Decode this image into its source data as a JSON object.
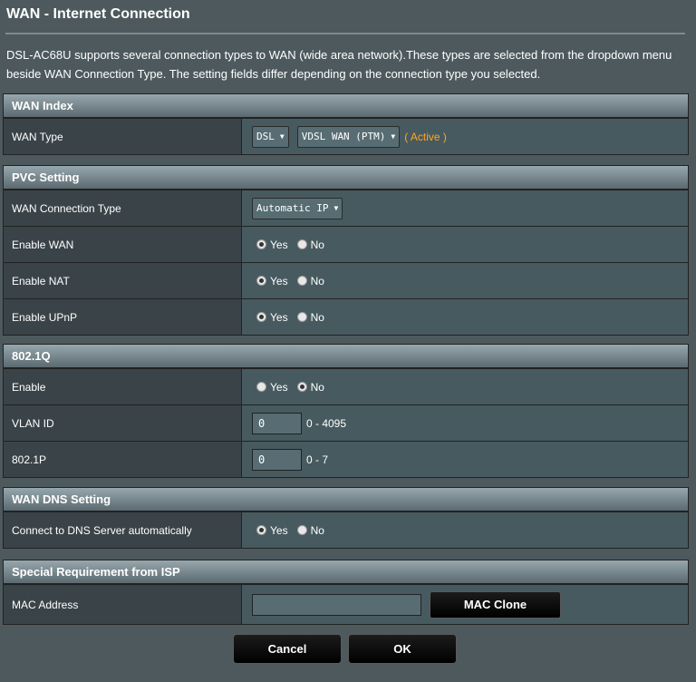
{
  "page": {
    "title": "WAN - Internet Connection",
    "description": "DSL-AC68U supports several connection types to WAN (wide area network).These types are selected from the dropdown menu beside WAN Connection Type. The setting fields differ depending on the connection type you selected."
  },
  "wan_index": {
    "header": "WAN Index",
    "wan_type_label": "WAN Type",
    "wan_type_select": "DSL",
    "wan_mode_select": "VDSL WAN (PTM)",
    "active_text": "( Active )"
  },
  "pvc": {
    "header": "PVC Setting",
    "conn_type_label": "WAN Connection Type",
    "conn_type_select": "Automatic IP",
    "enable_wan_label": "Enable WAN",
    "enable_nat_label": "Enable NAT",
    "enable_upnp_label": "Enable UPnP"
  },
  "dot1q": {
    "header": "802.1Q",
    "enable_label": "Enable",
    "vlan_label": "VLAN ID",
    "vlan_value": "0",
    "vlan_range": "0 - 4095",
    "p_label": "802.1P",
    "p_value": "0",
    "p_range": "0 - 7"
  },
  "dns": {
    "header": "WAN DNS Setting",
    "auto_label": "Connect to DNS Server automatically"
  },
  "isp": {
    "header": "Special Requirement from ISP",
    "mac_label": "MAC Address",
    "mac_value": "",
    "mac_clone_button": "MAC Clone"
  },
  "radio": {
    "yes": "Yes",
    "no": "No"
  },
  "footer": {
    "cancel": "Cancel",
    "ok": "OK"
  },
  "icons": {
    "dropdown": "chevron-down-icon"
  },
  "colors": {
    "background": "#4d595d",
    "active": "#ffa523"
  }
}
